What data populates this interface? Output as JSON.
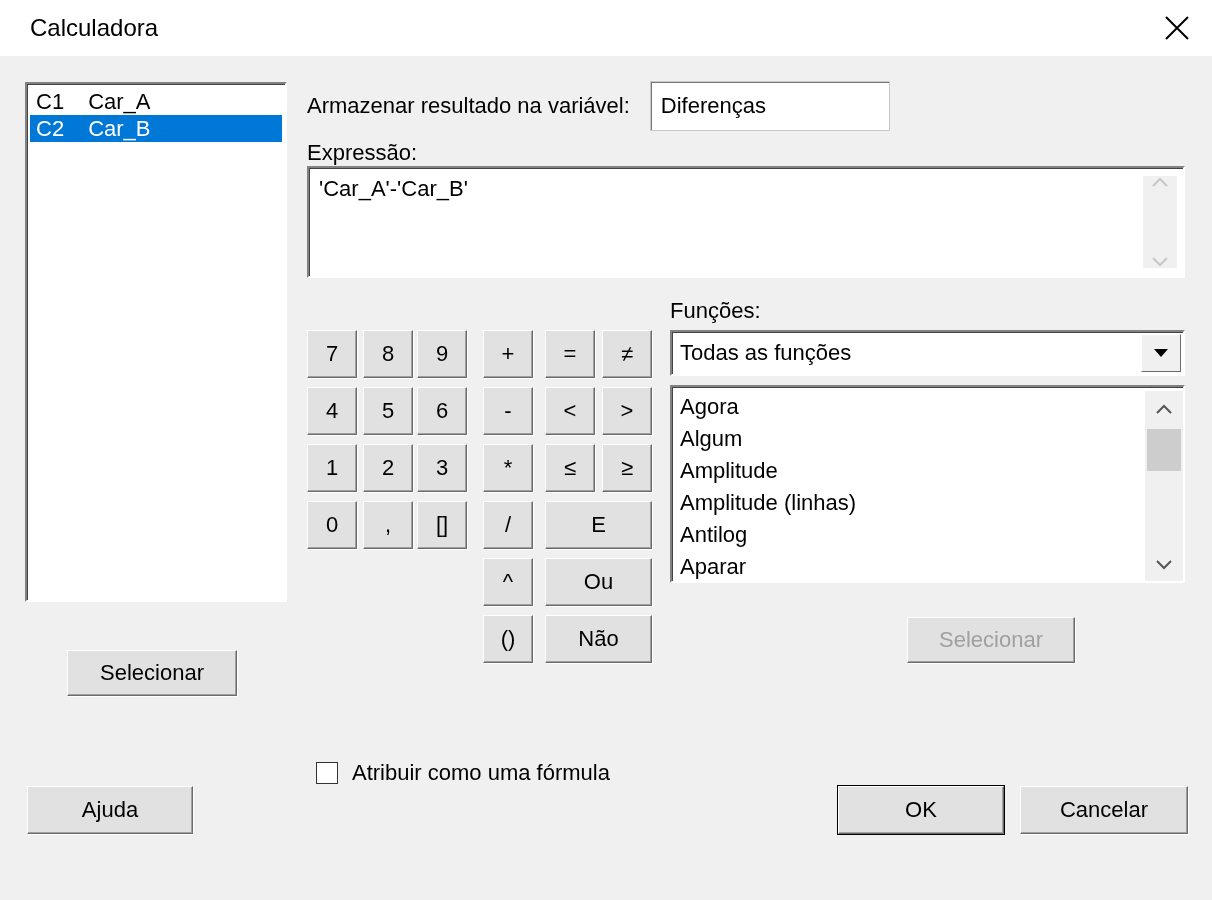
{
  "window": {
    "title": "Calculadora"
  },
  "columns": [
    {
      "id_label": "C1",
      "name": "Car_A",
      "selected": false
    },
    {
      "id_label": "C2",
      "name": "Car_B",
      "selected": true
    }
  ],
  "columns_select_button": {
    "label": "Selecionar",
    "disabled": false
  },
  "store_label": "Armazenar resultado na variável:",
  "store_value": "Diferenças",
  "expression_label": "Expressão:",
  "expression_value": "'Car_A'-'Car_B'",
  "digit_keys": [
    {
      "label": "7"
    },
    {
      "label": "8"
    },
    {
      "label": "9"
    },
    {
      "label": "4"
    },
    {
      "label": "5"
    },
    {
      "label": "6"
    },
    {
      "label": "1"
    },
    {
      "label": "2"
    },
    {
      "label": "3"
    },
    {
      "label": "0"
    },
    {
      "label": ","
    },
    {
      "label": "[]"
    }
  ],
  "operator_keys": [
    {
      "label": "+",
      "kind": "narrow"
    },
    {
      "label": "=",
      "kind": "narrow"
    },
    {
      "label": "≠",
      "kind": "narrow"
    },
    {
      "label": "-",
      "kind": "narrow"
    },
    {
      "label": "<",
      "kind": "narrow"
    },
    {
      "label": ">",
      "kind": "narrow"
    },
    {
      "label": "*",
      "kind": "narrow"
    },
    {
      "label": "≤",
      "kind": "narrow"
    },
    {
      "label": "≥",
      "kind": "narrow"
    },
    {
      "label": "/",
      "kind": "narrow"
    },
    {
      "label": "E",
      "kind": "wide"
    },
    {
      "label": "^",
      "kind": "narrow"
    },
    {
      "label": "Ou",
      "kind": "wide"
    },
    {
      "label": "()",
      "kind": "narrow"
    },
    {
      "label": "Não",
      "kind": "wide"
    }
  ],
  "functions_label": "Funções:",
  "functions_filter": "Todas as funções",
  "functions": [
    {
      "label": "Agora",
      "selected": false
    },
    {
      "label": "Algum",
      "selected": false
    },
    {
      "label": "Amplitude",
      "selected": false
    },
    {
      "label": "Amplitude (linhas)",
      "selected": false
    },
    {
      "label": "Antilog",
      "selected": false
    },
    {
      "label": "Aparar",
      "selected": false
    }
  ],
  "functions_select_button": {
    "label": "Selecionar",
    "disabled": true
  },
  "formula_checkbox": {
    "label": "Atribuir como uma fórmula",
    "checked": false
  },
  "buttons": [
    {
      "label": "Ajuda",
      "default": false
    },
    {
      "label": "OK",
      "default": true
    },
    {
      "label": "Cancelar",
      "default": false
    }
  ]
}
